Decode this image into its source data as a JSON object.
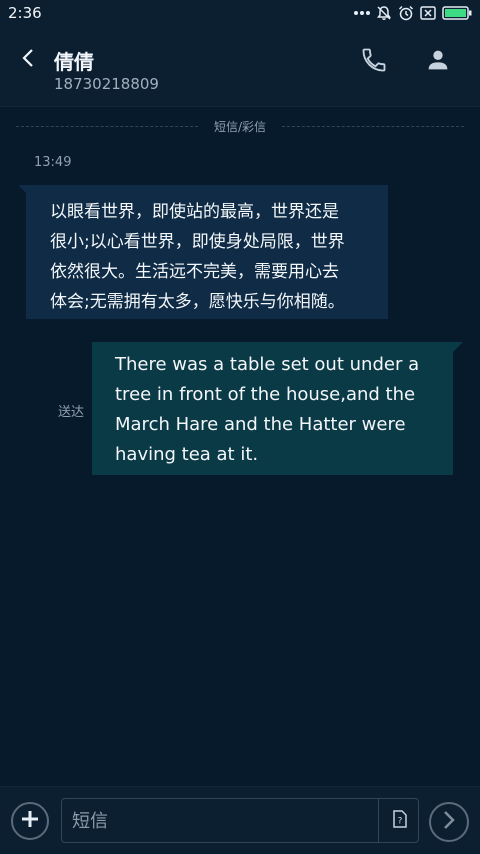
{
  "status_bar": {
    "time": "2:36",
    "icons": [
      "more-dots-icon",
      "notifications-off-icon",
      "alarm-icon",
      "sim-blocked-icon",
      "battery-icon"
    ],
    "battery_color": "#3ddc84"
  },
  "header": {
    "contact_name": "倩倩",
    "phone_number": "18730218809",
    "back_icon": "back-arrow-icon",
    "call_icon": "phone-icon",
    "contact_icon": "person-icon"
  },
  "conversation": {
    "divider_label": "短信/彩信",
    "timestamp": "13:49",
    "messages": [
      {
        "direction": "incoming",
        "lines": [
          "以眼看世界，即使站的最高，世界还是",
          "很小;以心看世界，即使身处局限，世界",
          "依然很大。生活远不完美，需要用心去",
          "体会;无需拥有太多，愿快乐与你相随。"
        ]
      },
      {
        "direction": "outgoing",
        "status": "送达",
        "lines": [
          "There was a table set out under a",
          "tree in front of the house,and the",
          "March Hare and the Hatter were",
          "having tea at it."
        ]
      }
    ]
  },
  "composer": {
    "placeholder": "短信",
    "add_icon": "plus-icon",
    "sim_icon": "sim-card-icon",
    "send_icon": "send-arrow-icon"
  },
  "colors": {
    "background": "#071a2c",
    "incoming_bubble": "#0f2b45",
    "outgoing_bubble": "#0b3a47"
  }
}
